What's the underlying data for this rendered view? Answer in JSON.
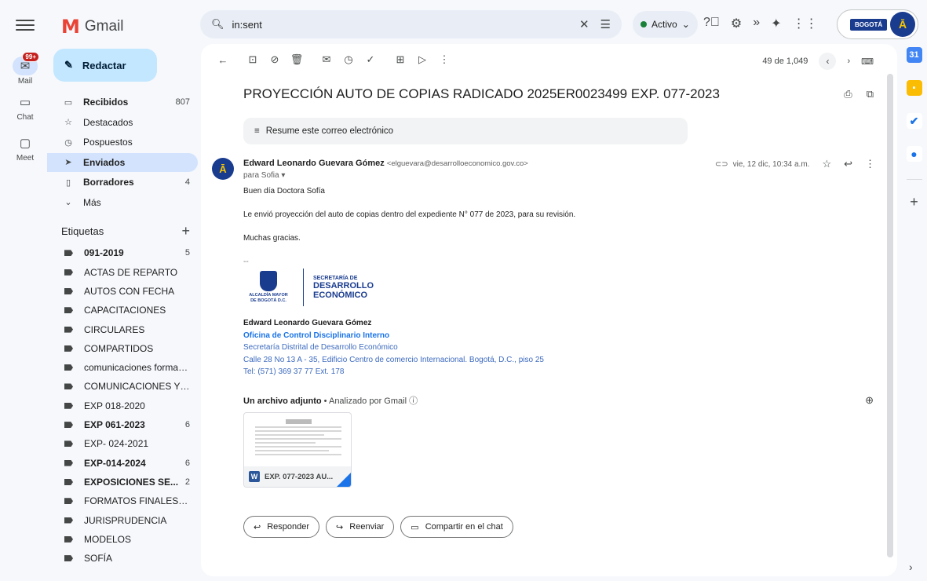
{
  "app": {
    "name": "Gmail"
  },
  "rail": {
    "mail_label": "Mail",
    "mail_badge": "99+",
    "chat_label": "Chat",
    "meet_label": "Meet"
  },
  "search": {
    "query": "in:sent"
  },
  "status": {
    "label": "Activo"
  },
  "org": {
    "badge": "BOGOTÁ"
  },
  "compose": {
    "label": "Redactar"
  },
  "nav": [
    {
      "label": "Recibidos",
      "count": "807",
      "bold": true,
      "icon": "inbox-icon"
    },
    {
      "label": "Destacados",
      "count": "",
      "bold": false,
      "icon": "star-icon"
    },
    {
      "label": "Pospuestos",
      "count": "",
      "bold": false,
      "icon": "clock-icon"
    },
    {
      "label": "Enviados",
      "count": "",
      "bold": true,
      "active": true,
      "icon": "send-icon"
    },
    {
      "label": "Borradores",
      "count": "4",
      "bold": true,
      "icon": "draft-icon"
    },
    {
      "label": "Más",
      "count": "",
      "bold": false,
      "icon": "chevron-down-icon"
    }
  ],
  "labels_heading": "Etiquetas",
  "labels": [
    {
      "label": "091-2019",
      "count": "5",
      "bold": true
    },
    {
      "label": "ACTAS DE REPARTO",
      "count": "",
      "bold": false
    },
    {
      "label": "AUTOS CON FECHA",
      "count": "",
      "bold": false
    },
    {
      "label": "CAPACITACIONES",
      "count": "",
      "bold": false
    },
    {
      "label": "CIRCULARES",
      "count": "",
      "bold": false
    },
    {
      "label": "COMPARTIDOS",
      "count": "",
      "bold": false
    },
    {
      "label": "comunicaciones formato...",
      "count": "",
      "bold": false
    },
    {
      "label": "COMUNICACIONES Y/O ...",
      "count": "",
      "bold": false
    },
    {
      "label": "EXP 018-2020",
      "count": "",
      "bold": false
    },
    {
      "label": "EXP 061-2023",
      "count": "6",
      "bold": true
    },
    {
      "label": "EXP- 024-2021",
      "count": "",
      "bold": false
    },
    {
      "label": "EXP-014-2024",
      "count": "6",
      "bold": true
    },
    {
      "label": "EXPOSICIONES SE...",
      "count": "2",
      "bold": true
    },
    {
      "label": "FORMATOS FINALES PR...",
      "count": "",
      "bold": false
    },
    {
      "label": "JURISPRUDENCIA",
      "count": "",
      "bold": false
    },
    {
      "label": "MODELOS",
      "count": "",
      "bold": false
    },
    {
      "label": "SOFÍA",
      "count": "",
      "bold": false
    }
  ],
  "pager": {
    "text": "49 de 1,049"
  },
  "email": {
    "subject": "PROYECCIÓN AUTO DE COPIAS RADICADO 2025ER0023499 EXP. 077-2023",
    "summary_label": "Resume este correo electrónico",
    "sender_name": "Edward Leonardo Guevara Gómez",
    "sender_email": "<elguevara@desarrolloeconomico.gov.co>",
    "to": "para Sofia",
    "date": "vie, 12 dic, 10:34 a.m.",
    "body": [
      "Buen día Doctora Sofía",
      "Le envió proyección del auto de copias dentro del expediente N° 077 de 2023, para su revisión.",
      "Muchas gracias."
    ],
    "separator": "--",
    "signature_logo": {
      "alcaldia_line1": "ALCALDÍA MAYOR",
      "alcaldia_line2": "DE BOGOTÁ D.C.",
      "secretaria": "SECRETARÍA DE",
      "desarrollo": "DESARROLLO",
      "economico": "ECONÓMICO"
    },
    "signature": {
      "name": "Edward Leonardo Guevara Gómez",
      "office": "Oficina de Control Disciplinario Interno",
      "entity": "Secretaría Distrital de Desarrollo Económico",
      "address": "Calle 28 No 13 A - 35, Edificio Centro de comercio Internacional. Bogotá, D.C., piso 25",
      "phone": "Tel: (571) 369 37 77 Ext. 178"
    },
    "attachments_heading": "Un archivo adjunto",
    "attachments_sub": " • Analizado por Gmail ⓘ",
    "attachment_name": "EXP. 077-2023 AU...",
    "actions": {
      "reply": "Responder",
      "forward": "Reenviar",
      "share": "Compartir en el chat"
    }
  },
  "colors": {
    "accent": "#1a73e8",
    "compose_bg": "#c2e7ff",
    "active_nav": "#d3e3fd",
    "brand_navy": "#1a3c8f"
  }
}
